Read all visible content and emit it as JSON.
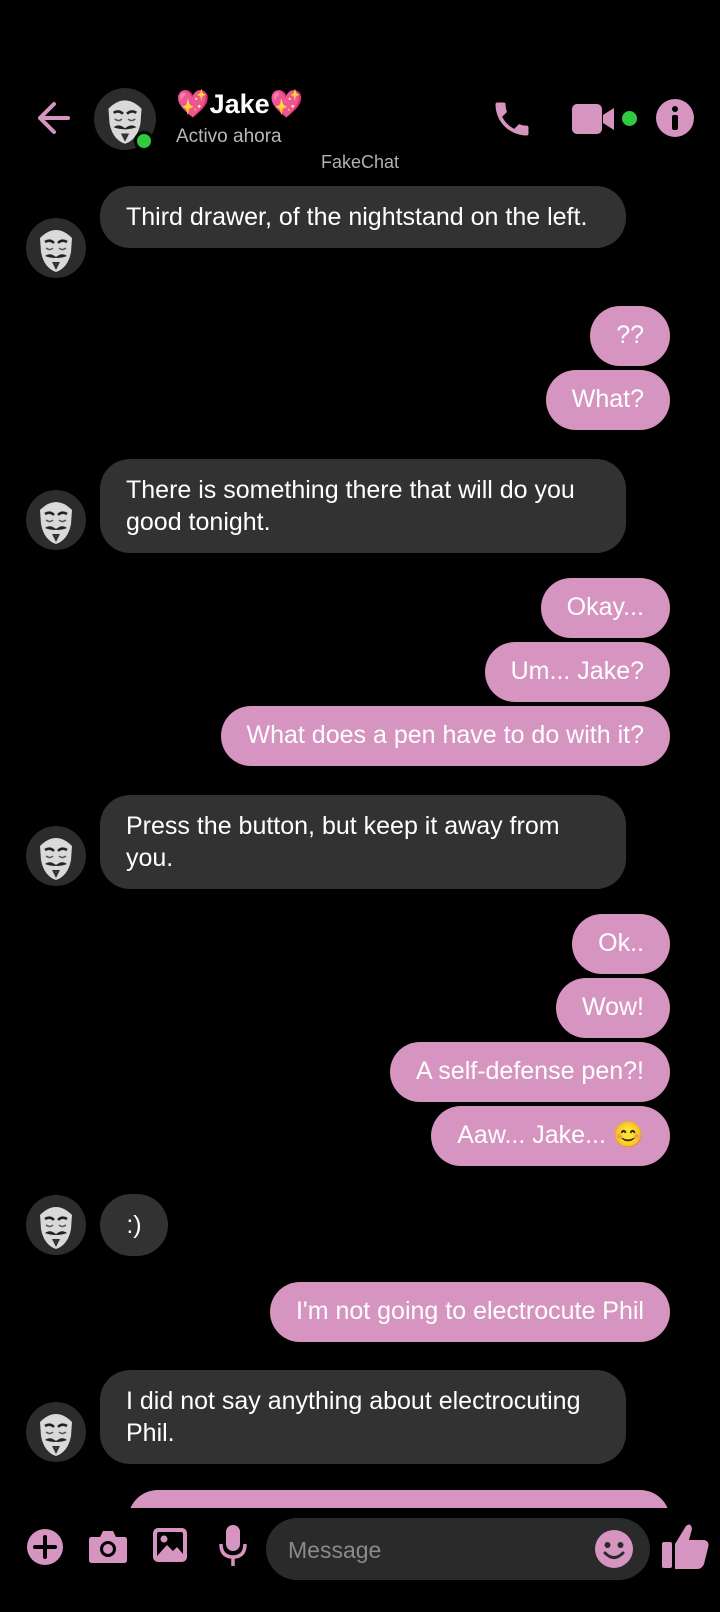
{
  "accent": "#d695c0",
  "header": {
    "contact_name": "💖Jake💖",
    "status": "Activo ahora",
    "app_label": "FakeChat",
    "icons": [
      "back-arrow-icon",
      "phone-icon",
      "video-camera-icon",
      "info-icon"
    ]
  },
  "messages": [
    {
      "side": "in",
      "text": "Third drawer, of the nightstand on the left."
    },
    {
      "side": "out",
      "text": "??"
    },
    {
      "side": "out",
      "text": "What?"
    },
    {
      "side": "in",
      "text": "There is something there that will do you good tonight."
    },
    {
      "side": "out",
      "text": "Okay..."
    },
    {
      "side": "out",
      "text": "Um... Jake?"
    },
    {
      "side": "out",
      "text": "What does a pen have to do with it?"
    },
    {
      "side": "in",
      "text": "Press the button, but keep it away from you."
    },
    {
      "side": "out",
      "text": "Ok.."
    },
    {
      "side": "out",
      "text": "Wow!"
    },
    {
      "side": "out",
      "text": "A self-defense pen?!"
    },
    {
      "side": "out",
      "text": "Aaw... Jake... 😊"
    },
    {
      "side": "in",
      "text": ":)"
    },
    {
      "side": "out",
      "text": "I'm not going to electrocute Phil"
    },
    {
      "side": "in",
      "text": "I did not say anything about electrocuting Phil."
    }
  ],
  "composer": {
    "placeholder": "Message",
    "icons": [
      "plus-icon",
      "camera-icon",
      "image-icon",
      "microphone-icon",
      "emoji-icon",
      "thumbs-up-icon"
    ]
  }
}
